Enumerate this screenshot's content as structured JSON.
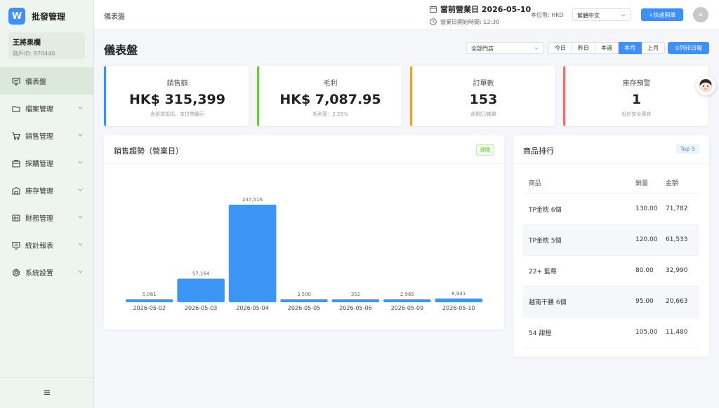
{
  "sidebar": {
    "logo": "W",
    "app_title": "批發管理",
    "merchant_name": "王將果欄",
    "merchant_id": "商戶ID: 970440",
    "items": [
      {
        "label": "儀表盤",
        "icon": "dashboard-icon",
        "active": true
      },
      {
        "label": "檔案管理",
        "icon": "folder-icon"
      },
      {
        "label": "銷售管理",
        "icon": "cart-icon"
      },
      {
        "label": "採購管理",
        "icon": "purchase-icon"
      },
      {
        "label": "庫存管理",
        "icon": "warehouse-icon"
      },
      {
        "label": "財務管理",
        "icon": "finance-icon"
      },
      {
        "label": "統計報表",
        "icon": "report-icon"
      },
      {
        "label": "系統設置",
        "icon": "gear-icon"
      }
    ],
    "collapse_icon": "≡"
  },
  "topbar": {
    "breadcrumb": "儀表盤",
    "business_day_label": "當前營業日 2026-05-10",
    "business_day_start": "營業日開始時間: 12:30",
    "currency": "本位幣: HKD",
    "language": "繁體中文",
    "quick_order": "+快速開單",
    "user_initial": "a"
  },
  "page": {
    "title": "儀表盤",
    "store_filter": "全部門店",
    "periods": [
      {
        "label": "今日"
      },
      {
        "label": "昨日"
      },
      {
        "label": "本週"
      },
      {
        "label": "本月",
        "active": true
      },
      {
        "label": "上月"
      }
    ],
    "print_label": "⊙列印日報"
  },
  "stats": [
    {
      "title": "銷售額",
      "value": "HK$ 315,399",
      "sub": "含退貨抵扣，本位幣顯示",
      "color": "#3d8eff"
    },
    {
      "title": "毛利",
      "value": "HK$ 7,087.95",
      "sub": "毛利率：2.25%",
      "color": "#6cc644"
    },
    {
      "title": "訂單數",
      "value": "153",
      "sub": "含預訂/補單",
      "color": "#e6a23c"
    },
    {
      "title": "庫存預警",
      "value": "1",
      "sub": "低於安全庫存",
      "color": "#f56c6c"
    }
  ],
  "sales_trend": {
    "title": "銷售趨勢（營業日）",
    "tag": "即時"
  },
  "chart_data": {
    "type": "bar",
    "categories": [
      "2026-05-02",
      "2026-05-03",
      "2026-05-04",
      "2026-05-05",
      "2026-05-06",
      "2026-05-09",
      "2026-05-10"
    ],
    "values": [
      5061,
      57164,
      237516,
      3500,
      352,
      2965,
      8941
    ],
    "value_labels": [
      "5,061",
      "57,164",
      "237,516",
      "3,500",
      "352",
      "2,965",
      "8,941"
    ],
    "color": "#3d95f5",
    "grid": false,
    "ylim": [
      0,
      237516
    ]
  },
  "ranking": {
    "title": "商品排行",
    "tag": "Top 5",
    "columns": [
      "商品",
      "銷量",
      "金額"
    ],
    "rows": [
      {
        "name": "TP金枕 6個",
        "qty": "130.00",
        "amount": "71,782"
      },
      {
        "name": "TP金枕 5個",
        "qty": "120.00",
        "amount": "61,533"
      },
      {
        "name": "22+ 藍莓",
        "qty": "80.00",
        "amount": "32,990"
      },
      {
        "name": "越南干腰 6個",
        "qty": "95.00",
        "amount": "20,663"
      },
      {
        "name": "54 甜橙",
        "qty": "105.00",
        "amount": "11,480"
      }
    ]
  }
}
